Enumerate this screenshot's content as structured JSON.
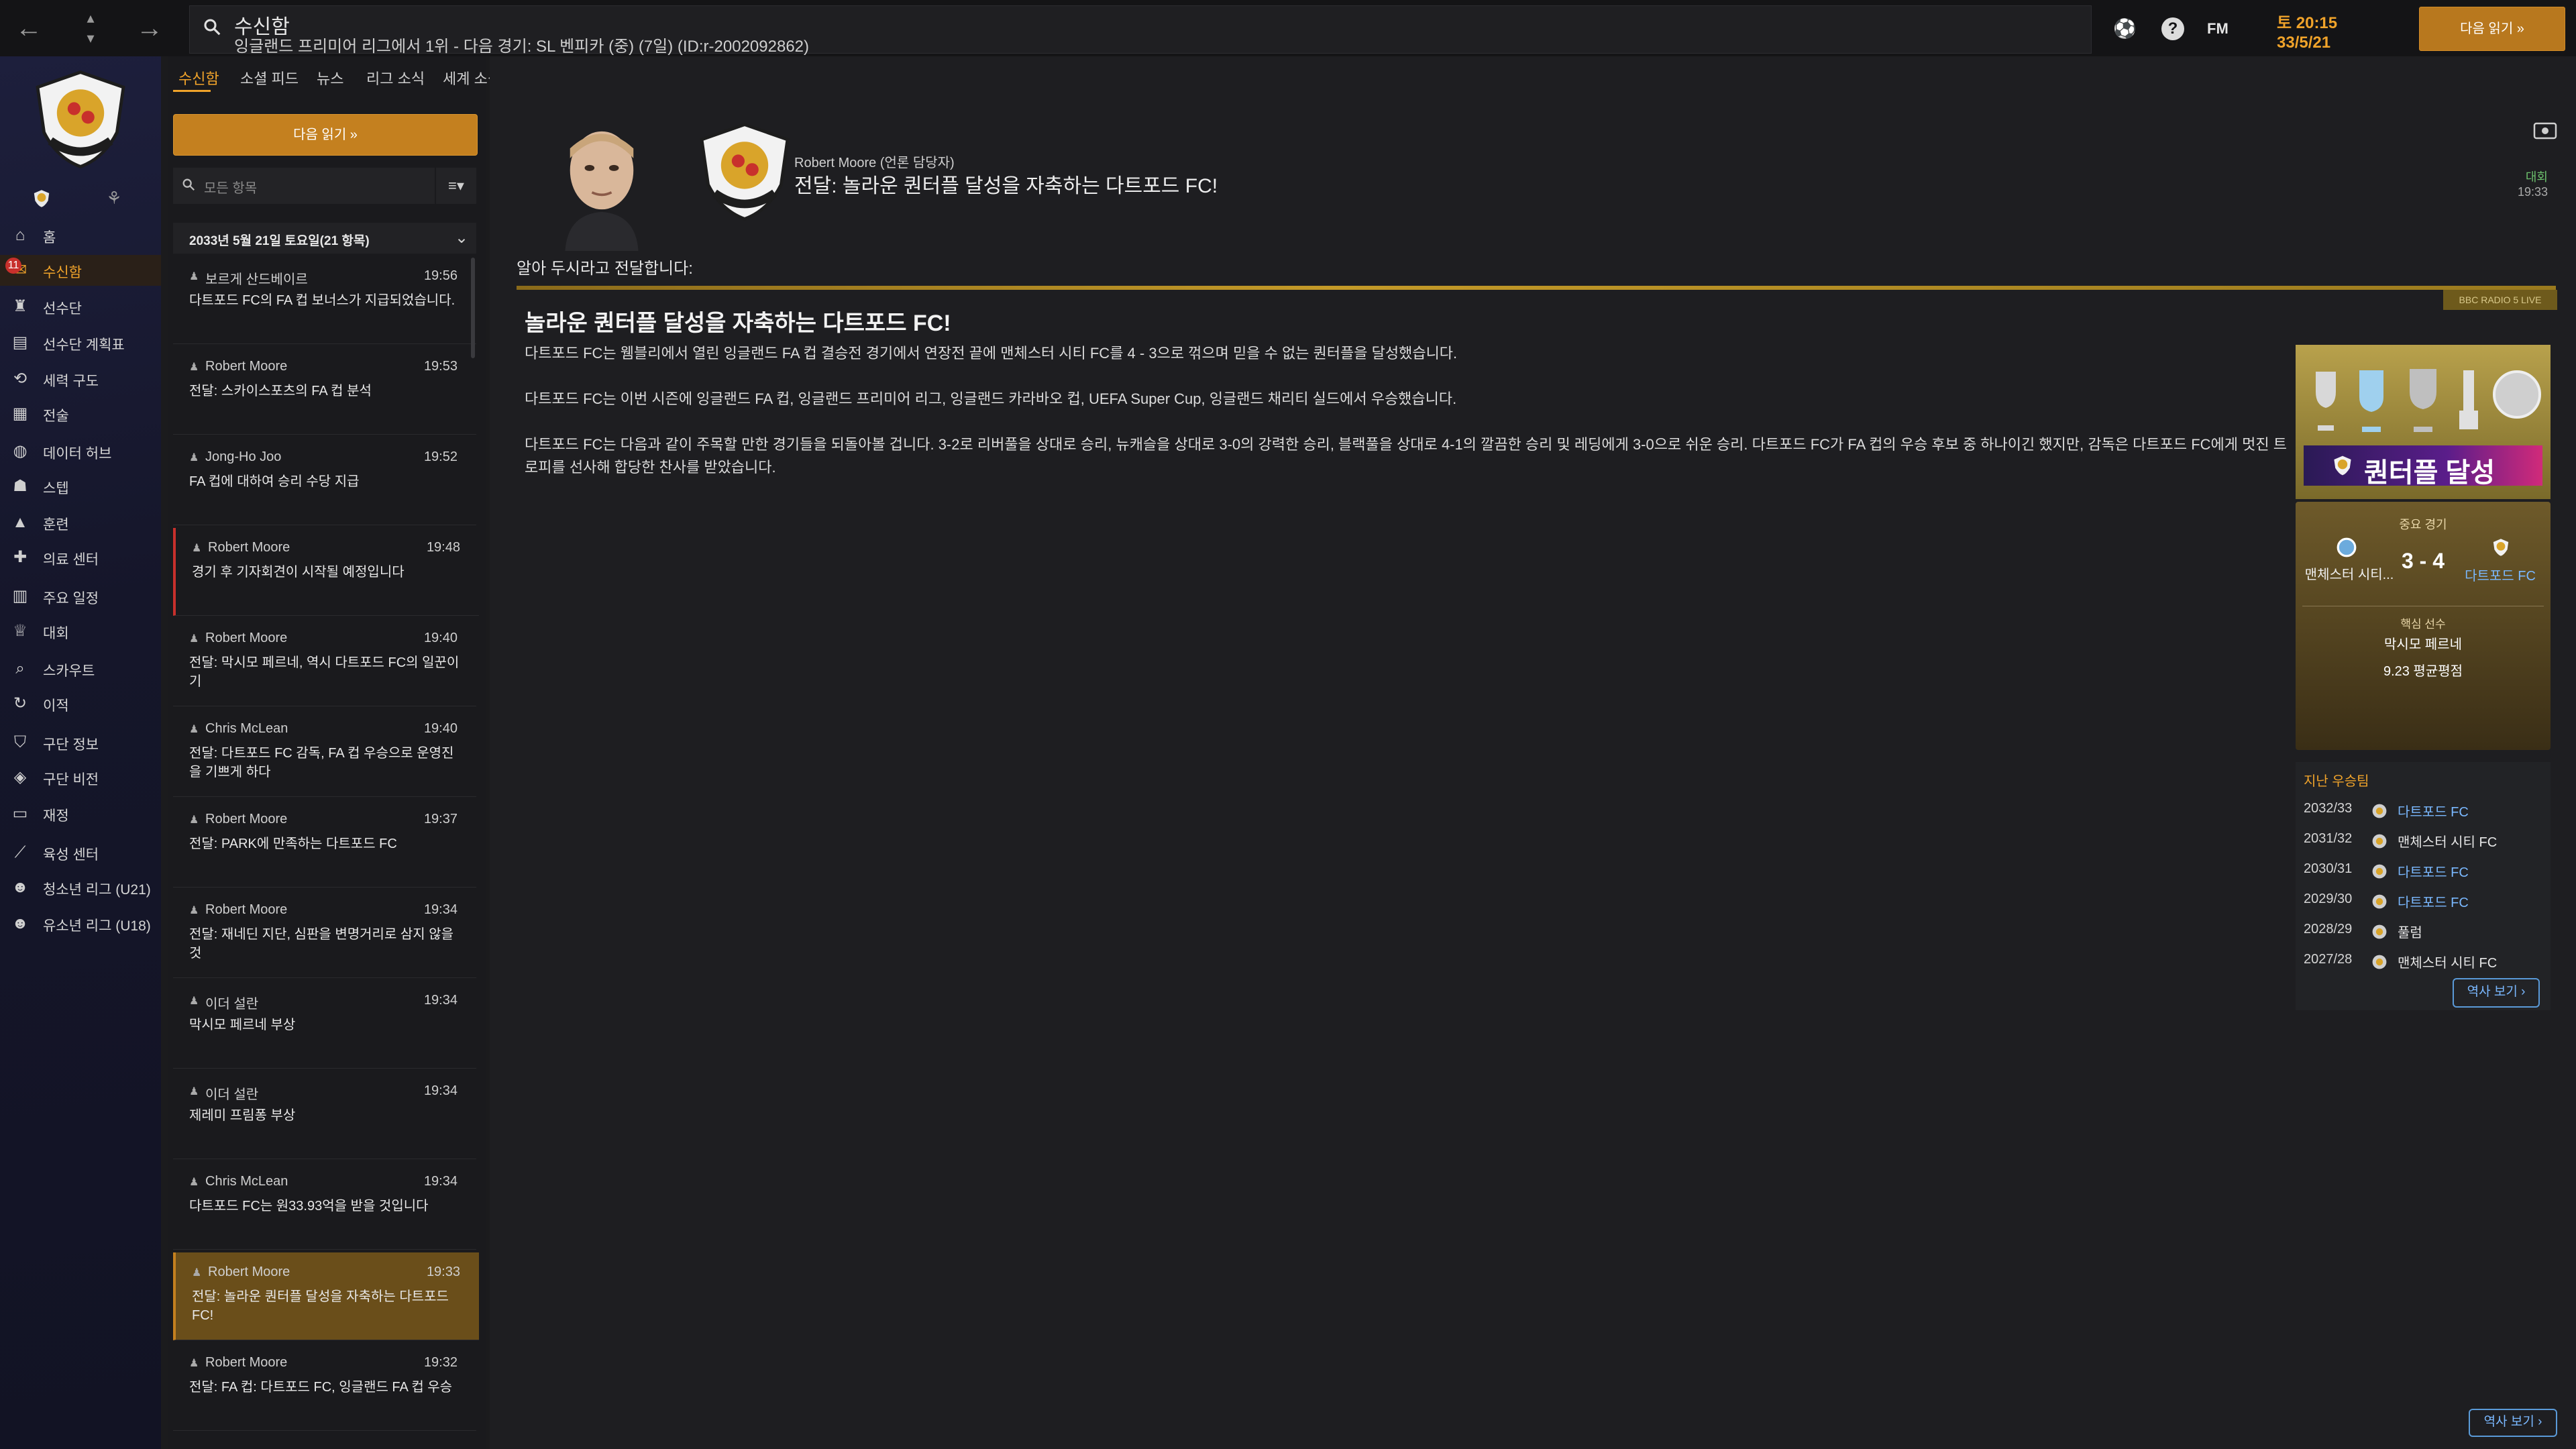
{
  "topbar": {
    "title": "수신함",
    "subtitle": "잉글랜드 프리미어 리그에서 1위 - 다음 경기: SL 벤피카 (중) (7일) (ID:r-2002092862)",
    "fm_label": "FM",
    "date_day": "토 20:15",
    "date_date": "33/5/21",
    "continue_label": "다음 읽기 »"
  },
  "nav": {
    "badge_count": "11",
    "items": [
      {
        "label": "홈",
        "icon": "home-icon"
      },
      {
        "label": "수신함",
        "icon": "inbox-icon"
      },
      {
        "label": "선수단",
        "icon": "shirt-icon"
      },
      {
        "label": "선수단 계획표",
        "icon": "clipboard-icon"
      },
      {
        "label": "세력 구도",
        "icon": "network-icon"
      },
      {
        "label": "전술",
        "icon": "tactics-icon"
      },
      {
        "label": "데이터 허브",
        "icon": "data-icon"
      },
      {
        "label": "스텝",
        "icon": "staff-icon"
      },
      {
        "label": "훈련",
        "icon": "training-icon"
      },
      {
        "label": "의료 센터",
        "icon": "medical-icon"
      },
      {
        "label": "주요 일정",
        "icon": "calendar-icon"
      },
      {
        "label": "대회",
        "icon": "trophy-icon"
      },
      {
        "label": "스카우트",
        "icon": "scout-icon"
      },
      {
        "label": "이적",
        "icon": "transfer-icon"
      },
      {
        "label": "구단 정보",
        "icon": "shield-icon"
      },
      {
        "label": "구단 비전",
        "icon": "vision-icon"
      },
      {
        "label": "재정",
        "icon": "money-icon"
      },
      {
        "label": "육성 센터",
        "icon": "development-icon"
      },
      {
        "label": "청소년 리그 (U21)",
        "icon": "youth-icon"
      },
      {
        "label": "유소년 리그 (U18)",
        "icon": "youth-icon"
      }
    ]
  },
  "mid": {
    "tabs": [
      "수신함",
      "소셜 피드",
      "뉴스",
      "리그 소식",
      "세계 소식"
    ],
    "continue_label": "다음 읽기 »",
    "filter_placeholder": "모든 항목",
    "sort_label": "≡▾",
    "group_label": "2033년 5월 21일 토요일(21 항목)",
    "messages": [
      {
        "sender": "보르게 산드베이르",
        "time": "19:56",
        "subject": "다트포드 FC의 FA 컵 보너스가 지급되었습니다."
      },
      {
        "sender": "Robert Moore",
        "time": "19:53",
        "subject": "전달: 스카이스포츠의 FA 컵 분석"
      },
      {
        "sender": "Jong-Ho Joo",
        "time": "19:52",
        "subject": "FA 컵에 대하여 승리 수당 지급"
      },
      {
        "sender": "Robert Moore",
        "time": "19:48",
        "subject": "경기 후 기자회견이 시작될 예정입니다"
      },
      {
        "sender": "Robert Moore",
        "time": "19:40",
        "subject": "전달: 막시모 페르네, 역시 다트포드 FC의 일꾼이기"
      },
      {
        "sender": "Chris McLean",
        "time": "19:40",
        "subject": "전달: 다트포드 FC 감독, FA 컵 우승으로 운영진을 기쁘게 하다"
      },
      {
        "sender": "Robert Moore",
        "time": "19:37",
        "subject": "전달: PARK에 만족하는 다트포드 FC"
      },
      {
        "sender": "Robert Moore",
        "time": "19:34",
        "subject": "전달: 재네딘 지단, 심판을 변명거리로 삼지 않을 것"
      },
      {
        "sender": "이더 설란",
        "time": "19:34",
        "subject": "막시모 페르네 부상"
      },
      {
        "sender": "이더 설란",
        "time": "19:34",
        "subject": "제레미 프림퐁 부상"
      },
      {
        "sender": "Chris McLean",
        "time": "19:34",
        "subject": "다트포드 FC는 원33.93억을 받을 것입니다"
      },
      {
        "sender": "Robert Moore",
        "time": "19:33",
        "subject": "전달: 놀라운 퀀터플 달성을 자축하는 다트포드 FC!"
      },
      {
        "sender": "Robert Moore",
        "time": "19:32",
        "subject": "전달: FA 컵: 다트포드 FC, 잉글랜드 FA 컵 우승"
      }
    ]
  },
  "main": {
    "from": "Robert Moore (언론 담당자)",
    "subject": "전달: 놀라운 퀀터플 달성을 자축하는 다트포드 FC!",
    "tag_comp": "대회",
    "tag_time": "19:33",
    "intro": "알아 두시라고 전달합니다:",
    "radio_tag": "BBC RADIO 5 LIVE",
    "article_title": "놀라운 퀀터플 달성을 자축하는 다트포드 FC!",
    "p1": "다트포드 FC는 웸블리에서 열린 잉글랜드 FA 컵 결승전 경기에서 연장전 끝에 맨체스터 시티 FC를 4 - 3으로 꺾으며 믿을 수 없는 퀀터플을 달성했습니다.",
    "p2": "다트포드 FC는 이번 시즌에 잉글랜드 FA 컵, 잉글랜드 프리미어 리그, 잉글랜드 카라바오 컵, UEFA Super Cup, 잉글랜드 채리티 실드에서 우승했습니다.",
    "p3": "다트포드 FC는 다음과 같이 주목할 만한 경기들을 되돌아볼 겁니다. 3-2로 리버풀을 상대로 승리, 뉴캐슬을 상대로 3-0의 강력한 승리, 블랙풀을 상대로 4-1의 깔끔한 승리 및 레딩에게 3-0으로 쉬운 승리. 다트포드 FC가 FA 컵의 우승 후보 중 하나이긴 했지만,  감독은 다트포드 FC에게 멋진 트로피를 선사해 합당한 찬사를 받았습니다."
  },
  "side": {
    "treble_text": "퀀터플 달성",
    "key_match_label": "중요 경기",
    "home_name": "맨체스터 시티...",
    "score": "3 - 4",
    "away_name": "다트포드 FC",
    "key_player_label": "핵심 선수",
    "key_player_name": "막시모 페르네",
    "key_player_rating": "9.23 평균평점",
    "history_label": "지난 우승팀",
    "history": [
      {
        "season": "2032/33",
        "club": "다트포드 FC",
        "color": "#7ab8ff"
      },
      {
        "season": "2031/32",
        "club": "맨체스터 시티 FC",
        "color": "#e6e6e6"
      },
      {
        "season": "2030/31",
        "club": "다트포드 FC",
        "color": "#7ab8ff"
      },
      {
        "season": "2029/30",
        "club": "다트포드 FC",
        "color": "#7ab8ff"
      },
      {
        "season": "2028/29",
        "club": "풀럼",
        "color": "#e6e6e6"
      },
      {
        "season": "2027/28",
        "club": "맨체스터 시티 FC",
        "color": "#e6e6e6"
      }
    ],
    "history_btn": "역사 보기 ›"
  }
}
